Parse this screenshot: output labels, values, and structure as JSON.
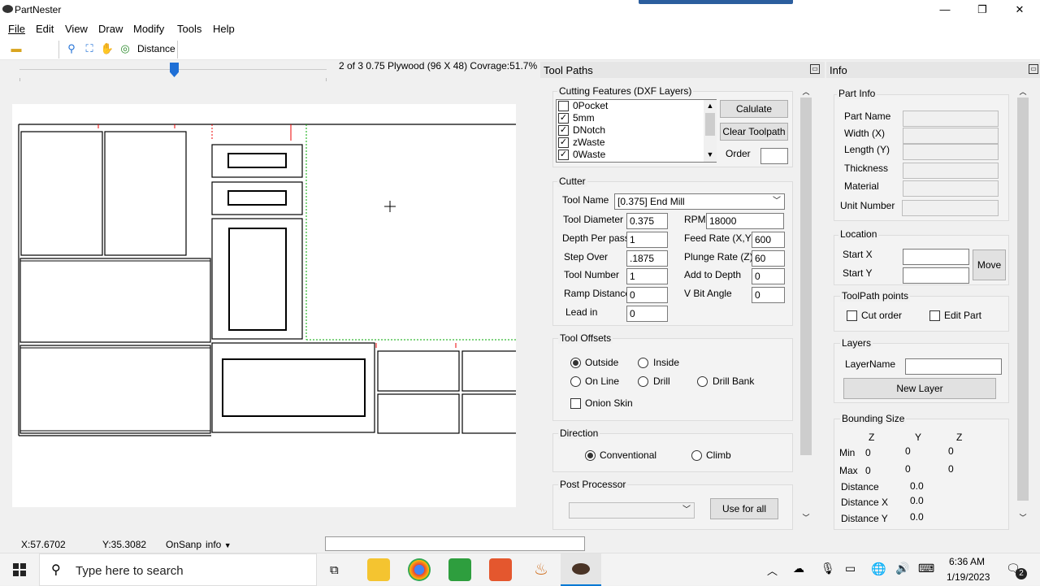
{
  "window": {
    "title": "PartNester",
    "controls": {
      "minimize": "—",
      "restore": "❐",
      "close": "✕"
    }
  },
  "menu": [
    "File",
    "Edit",
    "View",
    "Draw",
    "Modify",
    "Tools",
    "Help"
  ],
  "toolbar": {
    "icons": [
      "folder-icon",
      "zoom-icon",
      "zoom-extents-icon",
      "pan-hand-icon",
      "measure-icon"
    ],
    "distance_label": "Distance"
  },
  "sheet": {
    "info": "2 of 3  0.75 Plywood (96 X 48) Covrage:51.7%",
    "slider_position": 0.5
  },
  "toolpaths": {
    "title": "Tool Paths",
    "cutting_features": {
      "label": "Cutting Features (DXF Layers)",
      "layers": [
        {
          "name": "0Pocket",
          "checked": false
        },
        {
          "name": "5mm",
          "checked": true
        },
        {
          "name": "DNotch",
          "checked": true
        },
        {
          "name": "zWaste",
          "checked": true
        },
        {
          "name": "0Waste",
          "checked": true
        }
      ],
      "calculate_label": "Calulate",
      "clear_label": "Clear Toolpath",
      "order_label": "Order",
      "order_value": ""
    },
    "cutter": {
      "label": "Cutter",
      "tool_name_label": "Tool Name",
      "tool_name_value": "[0.375] End Mill",
      "tool_diameter_label": "Tool Diameter",
      "tool_diameter_value": "0.375",
      "rpm_label": "RPM",
      "rpm_value": "18000",
      "depth_per_pass_label": "Depth Per pass",
      "depth_per_pass_value": "1",
      "feed_rate_label": "Feed Rate (X,Y)",
      "feed_rate_value": "600",
      "step_over_label": "Step Over",
      "step_over_value": ".1875",
      "plunge_rate_label": "Plunge Rate (Z)",
      "plunge_rate_value": "60",
      "tool_number_label": "Tool Number",
      "tool_number_value": "1",
      "add_to_depth_label": "Add to Depth",
      "add_to_depth_value": "0",
      "ramp_distance_label": "Ramp Distance",
      "ramp_distance_value": "0",
      "vbit_angle_label": "V Bit Angle",
      "vbit_angle_value": "0",
      "lead_in_label": "Lead in",
      "lead_in_value": "0"
    },
    "offsets": {
      "label": "Tool Offsets",
      "outside": "Outside",
      "inside": "Inside",
      "on_line": "On Line",
      "drill": "Drill",
      "drill_bank": "Drill Bank",
      "onion_skin": "Onion Skin",
      "selected": "outside"
    },
    "direction": {
      "label": "Direction",
      "conventional": "Conventional",
      "climb": "Climb",
      "selected": "conventional"
    },
    "post_processor": {
      "label": "Post Processor",
      "value": "",
      "use_for_all": "Use for all"
    }
  },
  "info": {
    "title": "Info",
    "part_info": {
      "label": "Part Info",
      "part_name": "Part Name",
      "width": "Width (X)",
      "length": "Length (Y)",
      "thickness": "Thickness",
      "material": "Material",
      "unit_number": "Unit Number"
    },
    "location": {
      "label": "Location",
      "start_x": "Start X",
      "start_y": "Start Y",
      "move": "Move"
    },
    "toolpath_points": {
      "label": "ToolPath points",
      "cut_order": "Cut order",
      "edit_part": "Edit Part"
    },
    "layers": {
      "label": "Layers",
      "layer_name": "LayerName",
      "new_layer": "New Layer"
    },
    "bounding": {
      "label": "Bounding Size",
      "col1": "Z",
      "col2": "Y",
      "col3": "Z",
      "min_label": "Min",
      "max_label": "Max",
      "min": [
        "0",
        "0",
        "0"
      ],
      "max": [
        "0",
        "0",
        "0"
      ],
      "distance_label": "Distance",
      "distance_value": "0.0",
      "distance_x_label": "Distance X",
      "distance_x_value": "0.0",
      "distance_y_label": "Distance Y",
      "distance_y_value": "0.0"
    }
  },
  "status": {
    "x": "X:57.6702",
    "y": "Y:35.3082",
    "snap": "OnSanp",
    "info_menu": "info"
  },
  "taskbar": {
    "search_placeholder": "Type here to search",
    "time": "6:36 AM",
    "date": "1/19/2023",
    "notification_count": "2"
  }
}
